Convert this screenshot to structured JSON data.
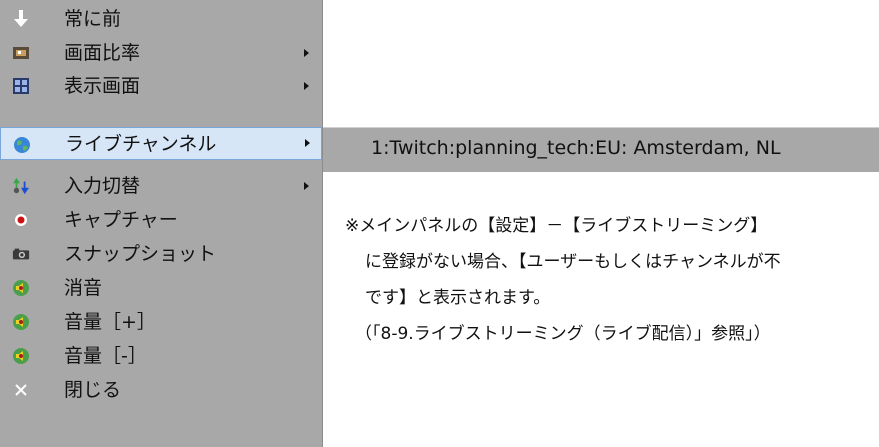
{
  "menu": {
    "items": [
      {
        "label": "常に前",
        "icon": "down-arrow-icon",
        "submenu": false
      },
      {
        "label": "画面比率",
        "icon": "aspect-ratio-icon",
        "submenu": true
      },
      {
        "label": "表示画面",
        "icon": "display-screen-icon",
        "submenu": true
      },
      {
        "label": "ライブチャンネル",
        "icon": "globe-icon",
        "submenu": true,
        "active": true
      },
      {
        "label": "入力切替",
        "icon": "input-switch-icon",
        "submenu": true
      },
      {
        "label": "キャプチャー",
        "icon": "record-icon",
        "submenu": false
      },
      {
        "label": "スナップショット",
        "icon": "camera-icon",
        "submenu": false
      },
      {
        "label": "消音",
        "icon": "speaker-icon",
        "submenu": false
      },
      {
        "label": "音量［+］",
        "icon": "speaker-icon",
        "submenu": false
      },
      {
        "label": "音量［-］",
        "icon": "speaker-icon",
        "submenu": false
      },
      {
        "label": "閉じる",
        "icon": "close-icon",
        "submenu": false
      }
    ]
  },
  "submenu": {
    "item": "1:Twitch:planning_tech:EU: Amsterdam, NL"
  },
  "note": {
    "line1": "※メインパネルの【設定】－【ライブストリーミング】",
    "line2": "に登録がない場合、【ユーザーもしくはチャンネルが不",
    "line3": "です】と表示されます。",
    "line4": "（「8-9.ライブストリーミング（ライブ配信）」参照」）"
  },
  "colors": {
    "menu_bg": "#a8a8a8",
    "highlight_bg": "#d6e6f7",
    "highlight_border": "#7aa7d9"
  }
}
